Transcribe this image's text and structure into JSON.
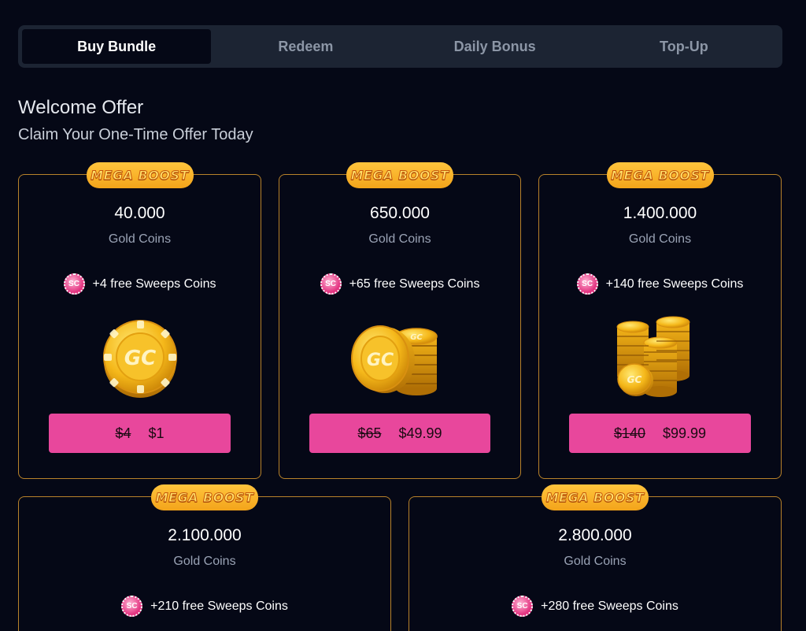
{
  "tabs": [
    {
      "label": "Buy Bundle",
      "active": true
    },
    {
      "label": "Redeem",
      "active": false
    },
    {
      "label": "Daily Bonus",
      "active": false
    },
    {
      "label": "Top-Up",
      "active": false
    }
  ],
  "heading": "Welcome Offer",
  "subheading": "Claim Your One-Time Offer Today",
  "badge_text": "MEGA BOOST",
  "sc_icon_text": "SC",
  "coin_text": "GC",
  "colors": {
    "background": "#050816",
    "card_border": "#b8822a",
    "price_button": "#e8479c",
    "badge": "#f3a41a"
  },
  "offers": [
    {
      "amount": "40.000",
      "unit": "Gold Coins",
      "bonus": "+4 free Sweeps Coins",
      "old_price": "$4",
      "price": "$1",
      "icon": "gold-coin-single"
    },
    {
      "amount": "650.000",
      "unit": "Gold Coins",
      "bonus": "+65 free Sweeps Coins",
      "old_price": "$65",
      "price": "$49.99",
      "icon": "gold-coin-stack"
    },
    {
      "amount": "1.400.000",
      "unit": "Gold Coins",
      "bonus": "+140 free Sweeps Coins",
      "old_price": "$140",
      "price": "$99.99",
      "icon": "gold-coin-piles"
    },
    {
      "amount": "2.100.000",
      "unit": "Gold Coins",
      "bonus": "+210 free Sweeps Coins"
    },
    {
      "amount": "2.800.000",
      "unit": "Gold Coins",
      "bonus": "+280 free Sweeps Coins"
    }
  ]
}
